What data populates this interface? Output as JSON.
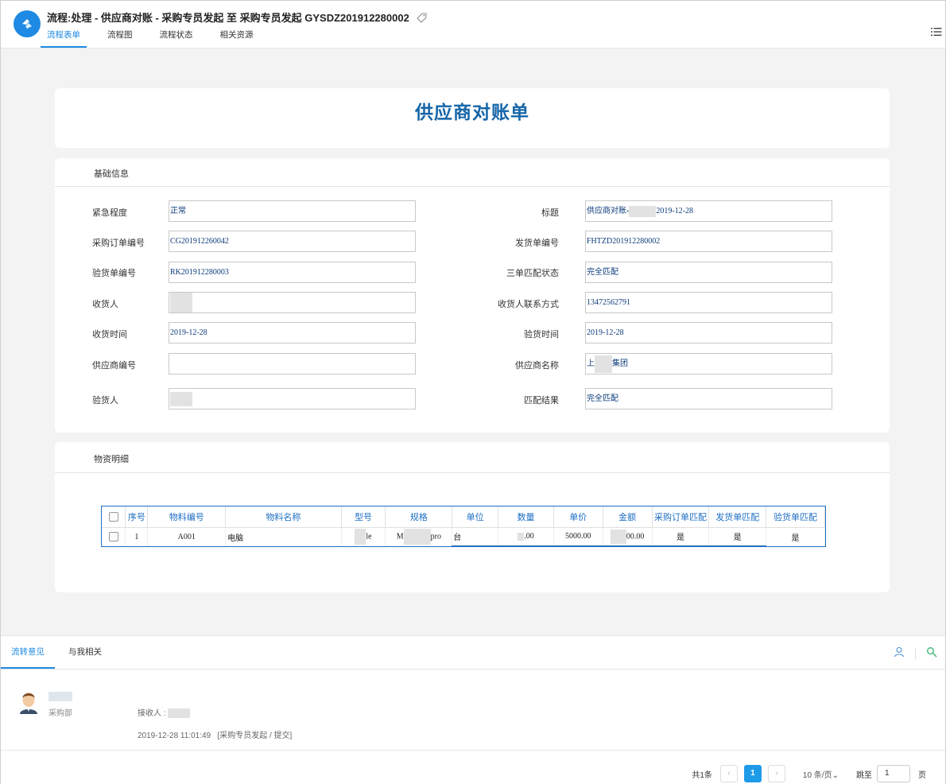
{
  "header": {
    "title": "流程:处理 - 供应商对账 - 采购专员发起 至 采购专员发起 GYSDZ201912280002",
    "tabs": [
      "流程表单",
      "流程图",
      "流程状态",
      "相关资源"
    ],
    "active_tab": 0
  },
  "form": {
    "title": "供应商对账单",
    "basic_section": "基础信息",
    "fields_left": [
      {
        "label": "紧急程度",
        "value": "正常"
      },
      {
        "label": "采购订单编号",
        "value": "CG201912260042"
      },
      {
        "label": "验货单编号",
        "value": "RK201912280003"
      },
      {
        "label": "收货人",
        "value": ""
      },
      {
        "label": "收货时间",
        "value": "2019-12-28"
      },
      {
        "label": "供应商编号",
        "value": ""
      },
      {
        "label": "验货人",
        "value": ""
      }
    ],
    "fields_right": [
      {
        "label": "标题",
        "value_prefix": "供应商对账-",
        "value_suffix": "2019-12-28"
      },
      {
        "label": "发货单编号",
        "value": "FHTZD201912280002"
      },
      {
        "label": "三单匹配状态",
        "value": "完全匹配"
      },
      {
        "label": "收货人联系方式",
        "value": "13472562791"
      },
      {
        "label": "验货时间",
        "value": "2019-12-28"
      },
      {
        "label": "供应商名称",
        "value_prefix": "上",
        "value_suffix": "集团"
      },
      {
        "label": "匹配结果",
        "value": "完全匹配"
      }
    ],
    "detail_section": "物资明细",
    "table": {
      "columns": [
        "序号",
        "物料编号",
        "物料名称",
        "型号",
        "规格",
        "单位",
        "数量",
        "单价",
        "金额",
        "采购订单匹配",
        "发货单匹配",
        "验货单匹配"
      ],
      "rows": [
        {
          "seq": "1",
          "code": "A001",
          "name": "电脑",
          "model": "le",
          "spec_prefix": "M",
          "spec_suffix": "pro",
          "unit": "台",
          "qty": ".00",
          "price": "5000.00",
          "amount": "00.00",
          "po_match": "是",
          "ship_match": "是",
          "insp_match": "是"
        }
      ]
    }
  },
  "bottom": {
    "tabs": [
      "流转意见",
      "与我相关"
    ],
    "active_tab": 0,
    "comment": {
      "dept": "采购部",
      "receiver_label": "接收人 :",
      "meta": "2019-12-28 11:01:49   [采购专员发起 / 提交]"
    },
    "pager": {
      "total": "共1条",
      "current": "1",
      "page_size": "10 条/页",
      "jump_label": "跳至",
      "jump_value": "1",
      "page_unit": "页"
    }
  },
  "colors": {
    "accent": "#1e8ae3",
    "title_blue": "#1565a8",
    "table_border": "#1e6fc4"
  }
}
